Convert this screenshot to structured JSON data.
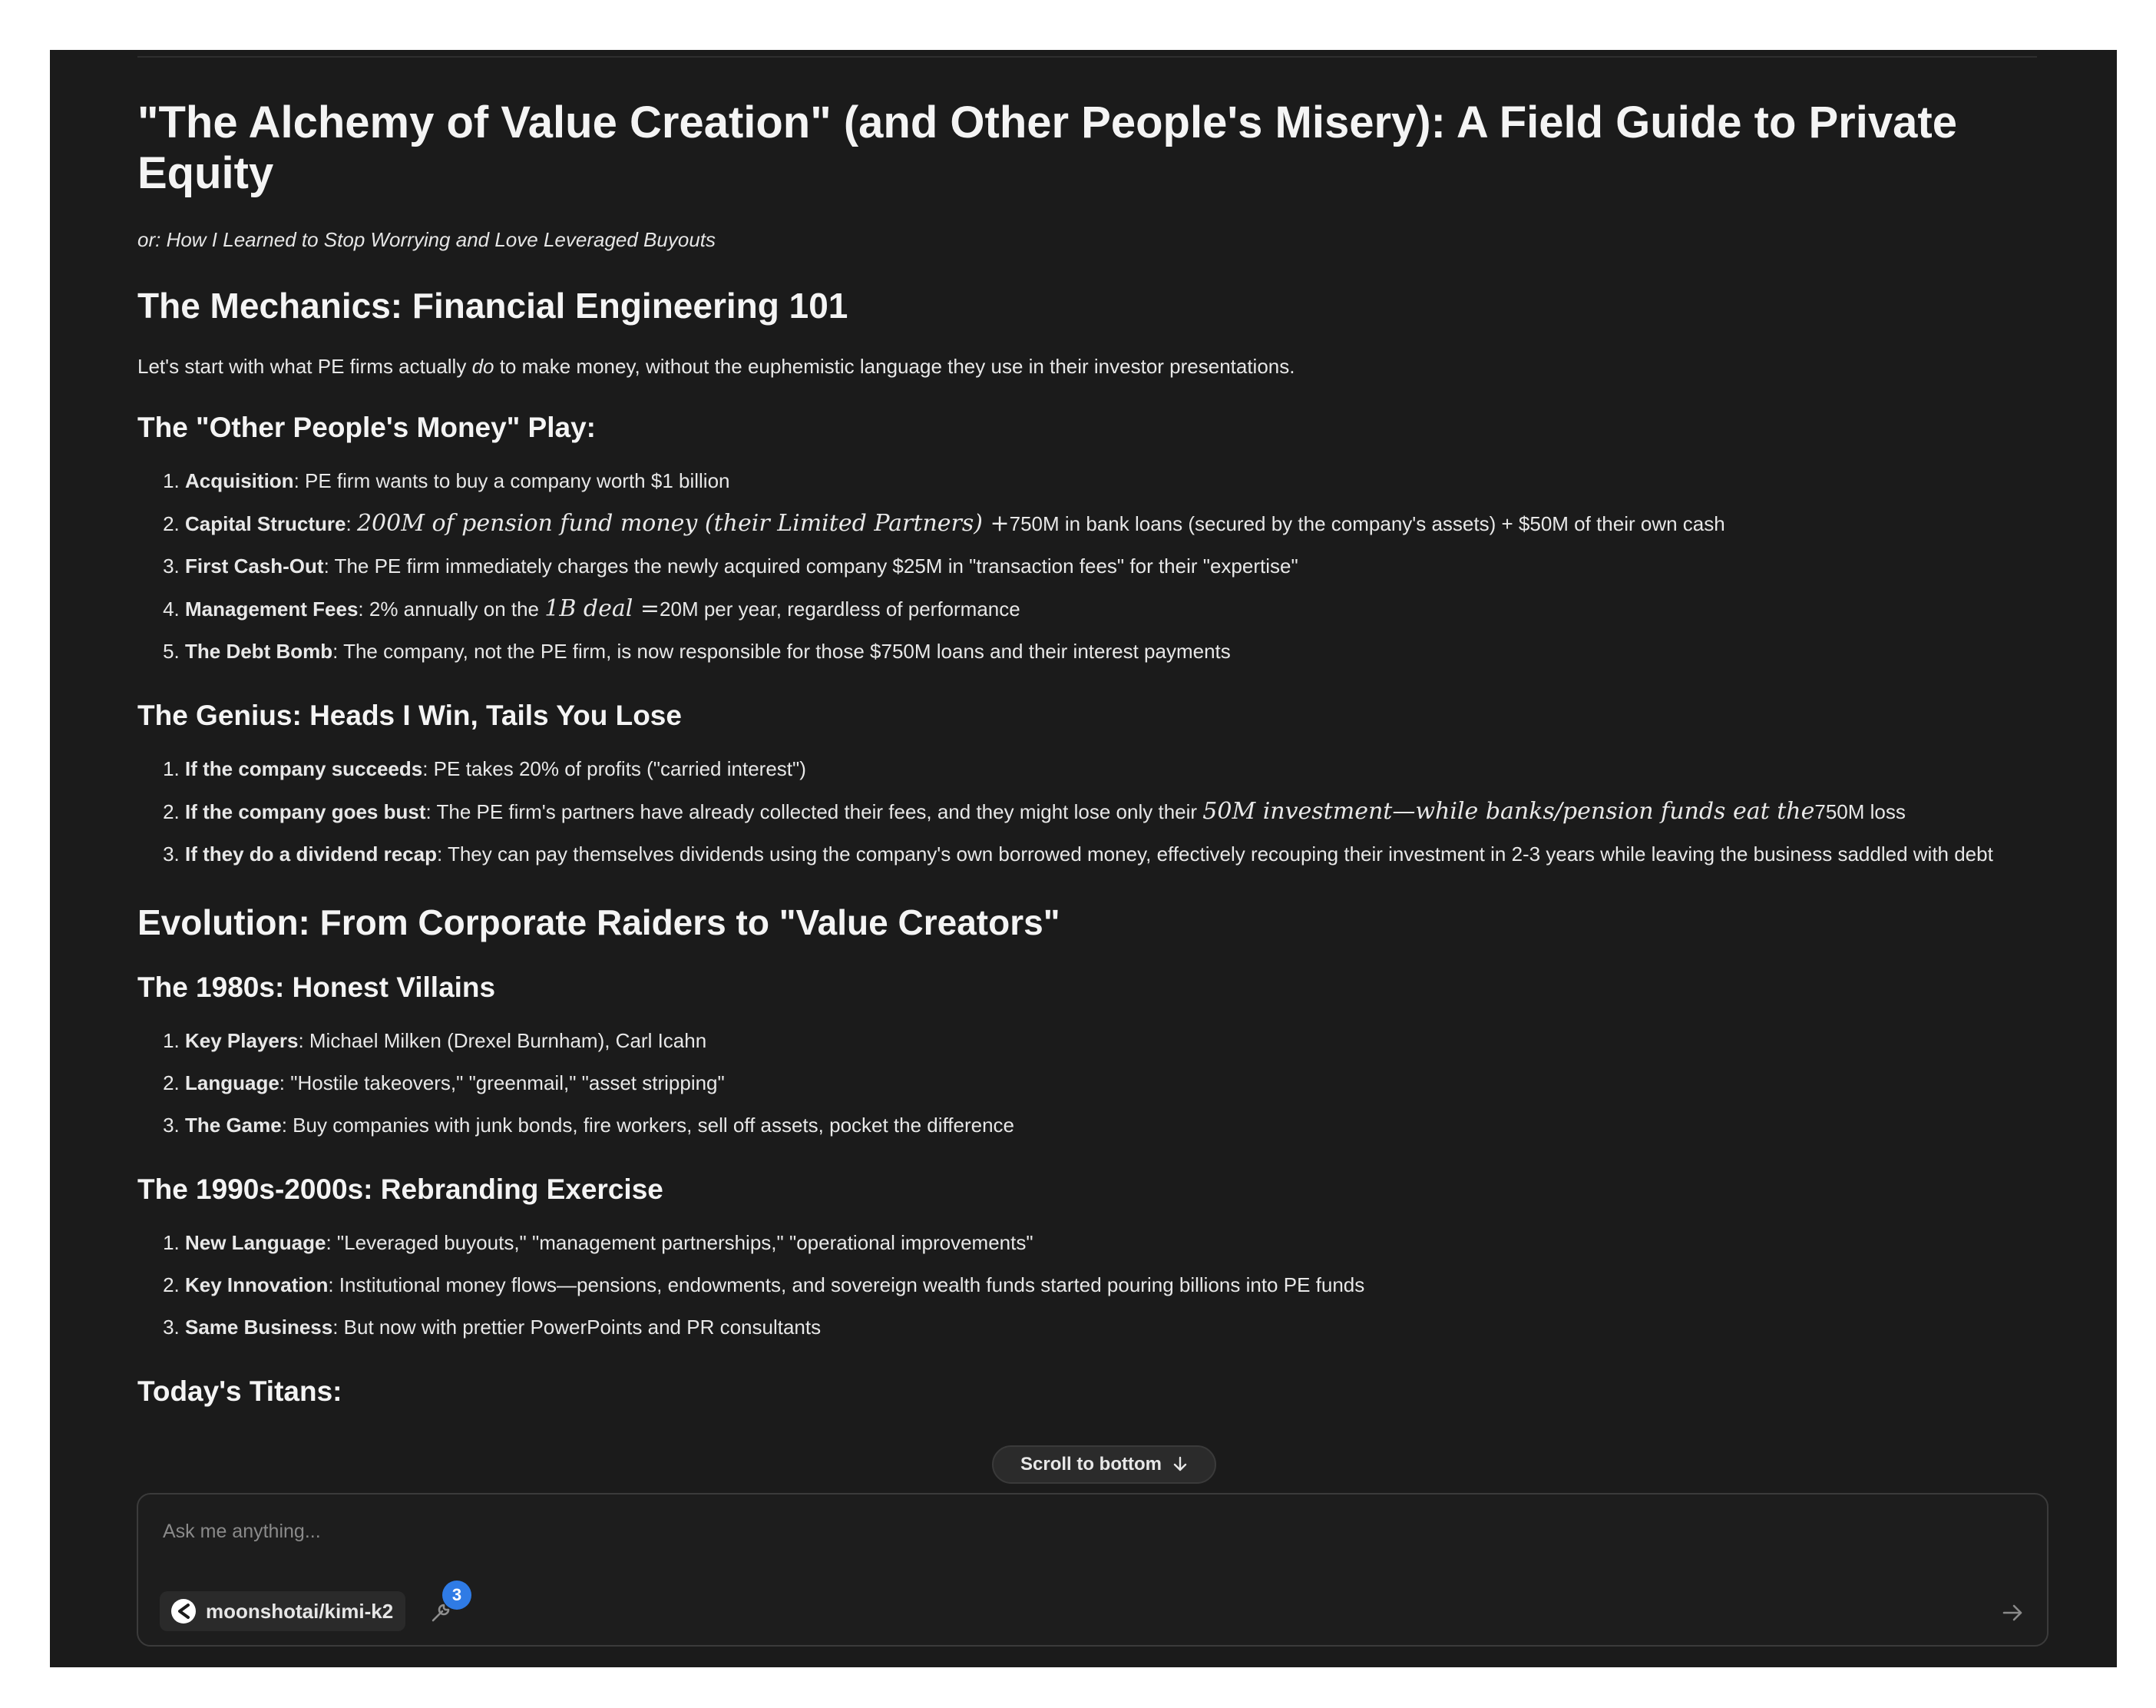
{
  "article": {
    "title": "\"The Alchemy of Value Creation\" (and Other People's Misery): A Field Guide to Private Equity",
    "subtitle": "or: How I Learned to Stop Worrying and Love Leveraged Buyouts",
    "mechanics": {
      "heading": "The Mechanics: Financial Engineering 101",
      "intro_before": "Let's start with what PE firms actually ",
      "intro_em": "do",
      "intro_after": " to make money, without the euphemistic language they use in their investor presentations.",
      "opm": {
        "heading": "The \"Other People's Money\" Play:",
        "items": [
          {
            "label": "Acquisition",
            "text": ": PE firm wants to buy a company worth $1 billion"
          },
          {
            "label": "Capital Structure",
            "text_before": ": ",
            "math": "200M of pension fund money (their Limited Partners) +",
            "text_after": "750M in bank loans (secured by the company's assets) + $50M of their own cash"
          },
          {
            "label": "First Cash-Out",
            "text": ": The PE firm immediately charges the newly acquired company $25M in \"transaction fees\" for their \"expertise\""
          },
          {
            "label": "Management Fees",
            "text_before": ": 2% annually on the ",
            "math": "1B deal =",
            "text_after": "20M per year, regardless of performance"
          },
          {
            "label": "The Debt Bomb",
            "text": ": The company, not the PE firm, is now responsible for those $750M loans and their interest payments"
          }
        ]
      },
      "genius": {
        "heading": "The Genius: Heads I Win, Tails You Lose",
        "items": [
          {
            "label": "If the company succeeds",
            "text": ": PE takes 20% of profits (\"carried interest\")"
          },
          {
            "label": "If the company goes bust",
            "text_before": ": The PE firm's partners have already collected their fees, and they might lose only their ",
            "math": "50M investment—while banks/pension funds eat the",
            "text_after": "750M loss"
          },
          {
            "label": "If they do a dividend recap",
            "text": ": They can pay themselves dividends using the company's own borrowed money, effectively recouping their investment in 2-3 years while leaving the business saddled with debt"
          }
        ]
      }
    },
    "evolution": {
      "heading": "Evolution: From Corporate Raiders to \"Value Creators\"",
      "eighties": {
        "heading": "The 1980s: Honest Villains",
        "items": [
          {
            "label": "Key Players",
            "text": ": Michael Milken (Drexel Burnham), Carl Icahn"
          },
          {
            "label": "Language",
            "text": ": \"Hostile takeovers,\" \"greenmail,\" \"asset stripping\""
          },
          {
            "label": "The Game",
            "text": ": Buy companies with junk bonds, fire workers, sell off assets, pocket the difference"
          }
        ]
      },
      "nineties": {
        "heading": "The 1990s-2000s: Rebranding Exercise",
        "items": [
          {
            "label": "New Language",
            "text": ": \"Leveraged buyouts,\" \"management partnerships,\" \"operational improvements\""
          },
          {
            "label": "Key Innovation",
            "text": ": Institutional money flows—pensions, endowments, and sovereign wealth funds started pouring billions into PE funds"
          },
          {
            "label": "Same Business",
            "text": ": But now with prettier PowerPoints and PR consultants"
          }
        ]
      },
      "titans_heading": "Today's Titans:"
    }
  },
  "scroll_button": {
    "label": "Scroll to bottom",
    "icon": "arrow-down-icon"
  },
  "composer": {
    "placeholder": "Ask me anything...",
    "model": "moonshotai/kimi-k2",
    "model_icon": "model-logo-icon",
    "tools_icon": "wrench-icon",
    "tools_count": "3",
    "send_icon": "arrow-right-icon"
  },
  "colors": {
    "background": "#1b1b1b",
    "text": "#e8e8e8",
    "badge": "#2f7be5"
  }
}
